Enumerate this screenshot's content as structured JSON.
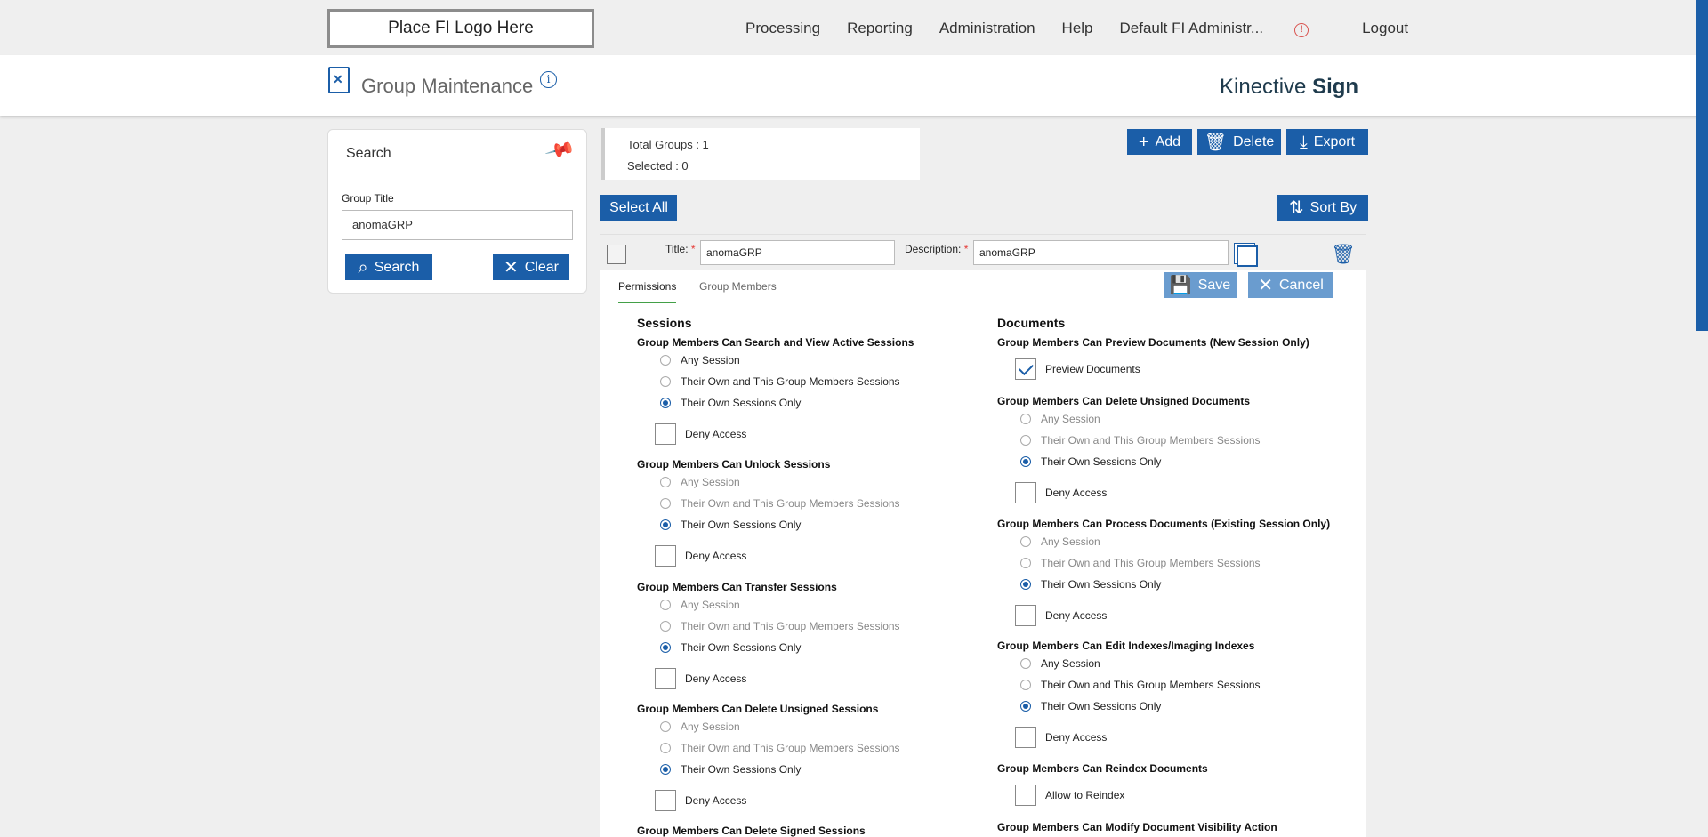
{
  "nav": {
    "logo": "Place FI Logo Here",
    "items": [
      "Processing",
      "Reporting",
      "Administration",
      "Help",
      "Default FI Administr...",
      "Logout"
    ],
    "alert_glyph": "!"
  },
  "header": {
    "title": "Group Maintenance",
    "info_glyph": "i",
    "brand_light": "Kinective ",
    "brand_bold": "Sign"
  },
  "search": {
    "title": "Search",
    "field_label": "Group Title",
    "field_value": "anomaGRP",
    "search_btn": "Search",
    "clear_btn": "Clear"
  },
  "totals": {
    "total": "Total Groups : 1",
    "selected": "Selected : 0"
  },
  "toolbar": {
    "add": "Add",
    "delete": "Delete",
    "export": "Export",
    "select_all": "Select All",
    "sort_by": "Sort By"
  },
  "group": {
    "title_label": "Title:",
    "title_value": "anomaGRP",
    "desc_label": "Description:",
    "desc_value": "anomaGRP",
    "required_mark": "*",
    "save": "Save",
    "cancel": "Cancel",
    "tabs": [
      "Permissions",
      "Group Members"
    ]
  },
  "options": {
    "any": "Any Session",
    "theirown_group": "Their Own and This Group Members Sessions",
    "own_only": "Their Own Sessions Only",
    "deny": "Deny Access"
  },
  "sessions": {
    "heading": "Sessions",
    "groups": [
      "Group Members Can Search and View Active Sessions",
      "Group Members Can Unlock Sessions",
      "Group Members Can Transfer Sessions",
      "Group Members Can Delete Unsigned Sessions",
      "Group Members Can Delete Signed Sessions"
    ]
  },
  "documents": {
    "heading": "Documents",
    "groups": [
      "Group Members Can Preview Documents (New Session Only)",
      "Group Members Can Delete Unsigned Documents",
      "Group Members Can Process Documents (Existing Session Only)",
      "Group Members Can Edit Indexes/Imaging Indexes",
      "Group Members Can Reindex Documents",
      "Group Members Can Modify Document Visibility Action"
    ],
    "preview_label": "Preview Documents",
    "reindex_label": "Allow to Reindex"
  },
  "colors": {
    "accent": "#1b5ea8",
    "tab_underline": "#43a047",
    "required": "#e53935"
  }
}
